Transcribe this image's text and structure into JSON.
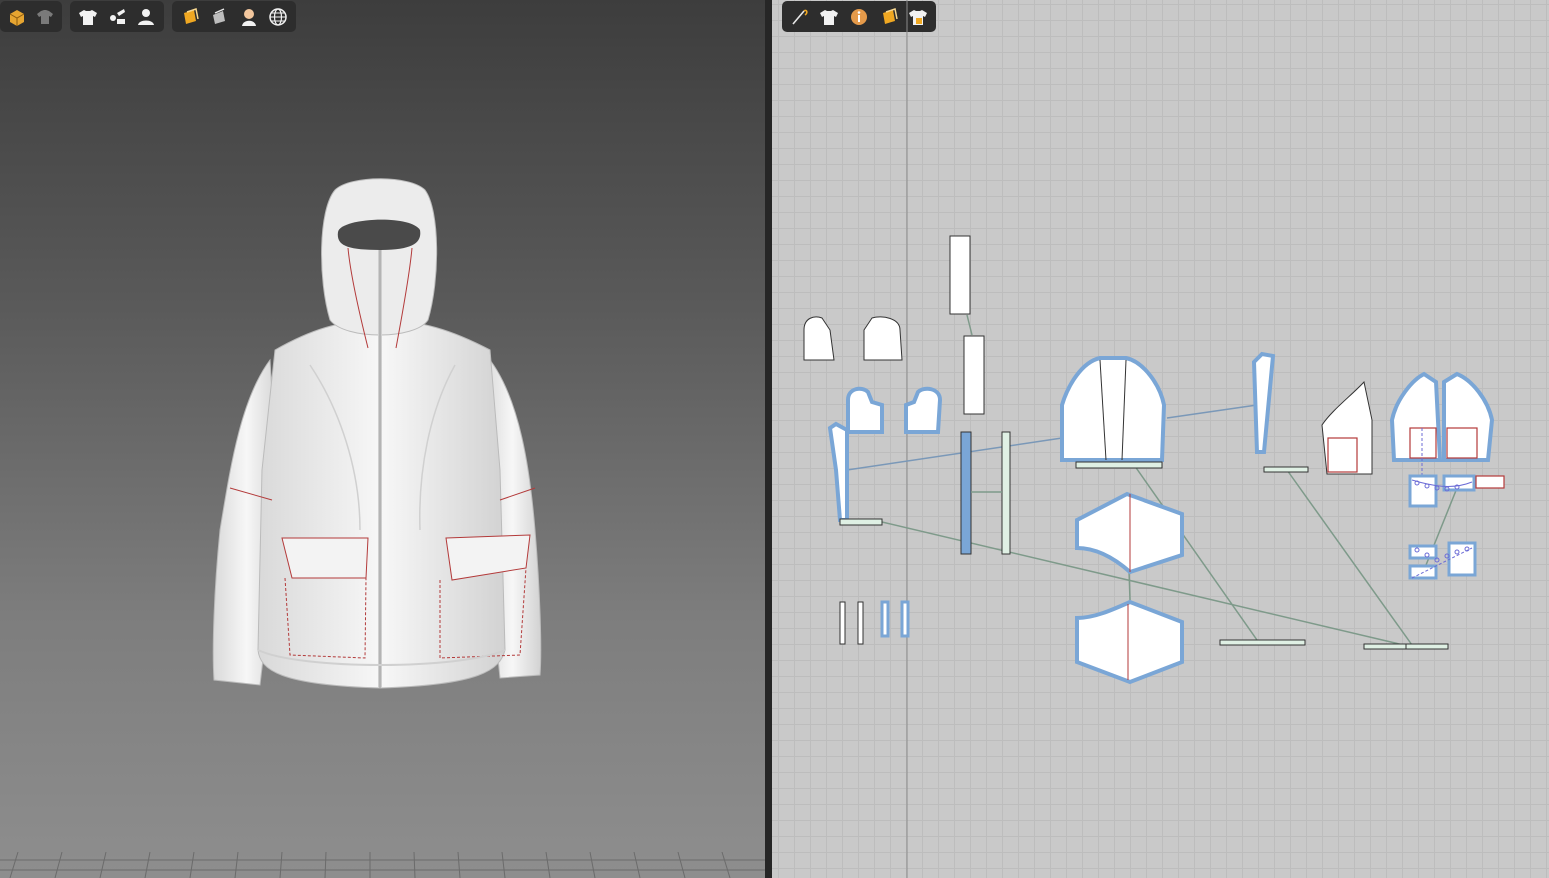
{
  "colors": {
    "toolbar_bg": "#2d2d2d",
    "pattern_outline_selected": "#7aa6d6",
    "seam_green": "#bfe0c8",
    "stitch_red": "#b33a3a",
    "grid_bg": "#c9c9c9"
  },
  "toolbar_3d_a": {
    "buttons": [
      {
        "icon": "avatar-box-icon"
      },
      {
        "icon": "garment-dark-icon"
      }
    ]
  },
  "toolbar_3d_b": {
    "buttons": [
      {
        "icon": "tshirt-icon"
      },
      {
        "icon": "fold-arrange-icon"
      },
      {
        "icon": "avatar-show-icon"
      }
    ]
  },
  "toolbar_3d_c": {
    "buttons": [
      {
        "icon": "texture-icon"
      },
      {
        "icon": "flat-texture-icon"
      },
      {
        "icon": "skin-icon"
      },
      {
        "icon": "globe-icon"
      }
    ]
  },
  "toolbar_2d": {
    "buttons": [
      {
        "icon": "needle-icon"
      },
      {
        "icon": "tshirt-icon"
      },
      {
        "icon": "info-icon"
      },
      {
        "icon": "texture-icon"
      },
      {
        "icon": "grading-icon"
      }
    ]
  },
  "scene": {
    "garment": "hooded-jacket"
  }
}
